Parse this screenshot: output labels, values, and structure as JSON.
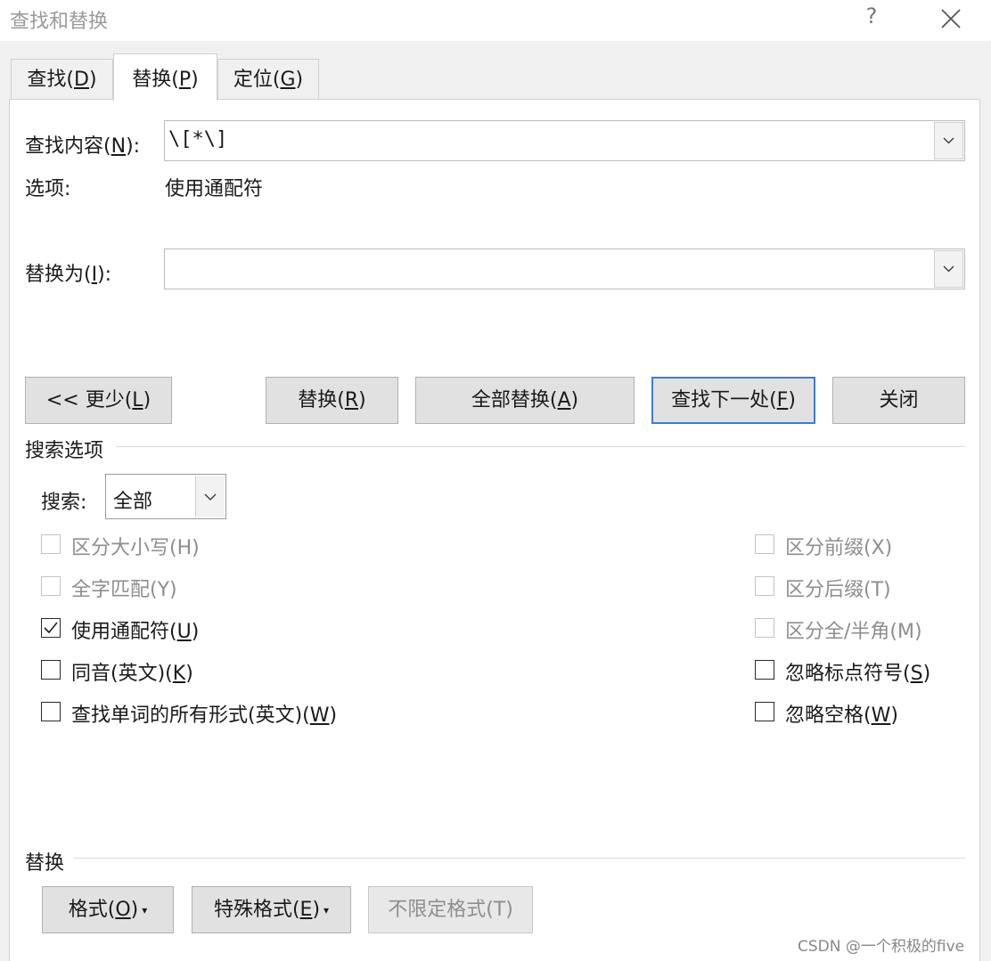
{
  "window": {
    "title": "查找和替换",
    "help_label": "?"
  },
  "tabs": [
    {
      "label_pre": "查找(",
      "label_key": "D",
      "label_post": ")"
    },
    {
      "label_pre": "替换(",
      "label_key": "P",
      "label_post": ")"
    },
    {
      "label_pre": "定位(",
      "label_key": "G",
      "label_post": ")"
    }
  ],
  "find": {
    "label_pre": "查找内容(",
    "label_key": "N",
    "label_post": "):",
    "value": "\\[*\\]",
    "options_label": "选项:",
    "options_value": "使用通配符"
  },
  "replace": {
    "label_pre": "替换为(",
    "label_key": "I",
    "label_post": "):",
    "value": ""
  },
  "buttons": {
    "less": {
      "pre": "<< 更少(",
      "key": "L",
      "post": ")"
    },
    "replace": {
      "pre": "替换(",
      "key": "R",
      "post": ")"
    },
    "replace_all": {
      "pre": "全部替换(",
      "key": "A",
      "post": ")"
    },
    "find_next": {
      "pre": "查找下一处(",
      "key": "F",
      "post": ")"
    },
    "close": "关闭"
  },
  "search_options": {
    "heading": "搜索选项",
    "search_label": "搜索:",
    "search_value": "全部",
    "left": [
      {
        "text": "区分大小写(H)",
        "checked": false,
        "disabled": true
      },
      {
        "text": "全字匹配(Y)",
        "checked": false,
        "disabled": true
      },
      {
        "text_pre": "使用通配符(",
        "key": "U",
        "text_post": ")",
        "checked": true,
        "disabled": false
      },
      {
        "text_pre": "同音(英文)(",
        "key": "K",
        "text_post": ")",
        "checked": false,
        "disabled": false
      },
      {
        "text_pre": "查找单词的所有形式(英文)(",
        "key": "W",
        "text_post": ")",
        "checked": false,
        "disabled": false
      }
    ],
    "right": [
      {
        "text": "区分前缀(X)",
        "checked": false,
        "disabled": true
      },
      {
        "text": "区分后缀(T)",
        "checked": false,
        "disabled": true
      },
      {
        "text": "区分全/半角(M)",
        "checked": false,
        "disabled": true
      },
      {
        "text_pre": "忽略标点符号(",
        "key": "S",
        "text_post": ")",
        "checked": false,
        "disabled": false
      },
      {
        "text_pre": "忽略空格(",
        "key": "W",
        "text_post": ")",
        "checked": false,
        "disabled": false
      }
    ]
  },
  "replace_section": {
    "heading": "替换",
    "format": {
      "pre": "格式(",
      "key": "O",
      "post": ")"
    },
    "special": {
      "pre": "特殊格式(",
      "key": "E",
      "post": ")"
    },
    "no_format": "不限定格式(T)",
    "caret": "▾"
  },
  "watermark": "CSDN @一个积极的five"
}
